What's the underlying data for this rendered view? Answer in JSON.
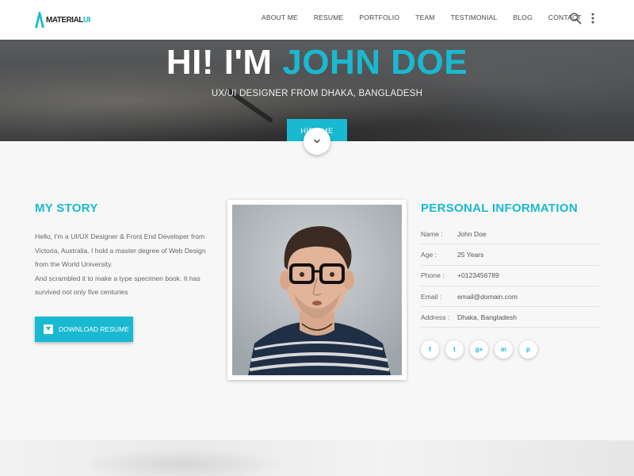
{
  "brand": {
    "logo_text_main": "MATERIAL",
    "logo_text_accent": "UI"
  },
  "nav": {
    "items": [
      "ABOUT ME",
      "RESUME",
      "PORTFOLIO",
      "TEAM",
      "TESTIMONIAL",
      "BLOG",
      "CONTACT"
    ],
    "search_icon": "search-icon",
    "more_icon": "more-vert-icon"
  },
  "hero": {
    "title_prefix": "HI! I'M ",
    "title_name": "JOHN DOE",
    "subtitle": "UX/UI DESIGNER FROM DHAKA, BANGLADESH",
    "hire_button": "HIRE ME"
  },
  "story": {
    "title": "MY STORY",
    "paragraph1": "Hello, I'm a UI/UX Designer & Front End Developer from Victoria, Australia. I hold a master degree of Web Design from the World University.",
    "paragraph2": "And scrambled it to make a type specimen book. It has survived not only five centuries",
    "download_button": "DOWNLOAD RESUME"
  },
  "personal": {
    "title": "PERSONAL INFORMATION",
    "rows": [
      {
        "label": "Name :",
        "value": "John Doe"
      },
      {
        "label": "Age :",
        "value": "25 Years"
      },
      {
        "label": "Phone :",
        "value": "+0123456789"
      },
      {
        "label": "Email :",
        "value": "email@domain.com"
      },
      {
        "label": "Address :",
        "value": "Dhaka, Bangladesh"
      }
    ],
    "socials": [
      {
        "name": "facebook-icon",
        "glyph": "f"
      },
      {
        "name": "twitter-icon",
        "glyph": "t"
      },
      {
        "name": "google-plus-icon",
        "glyph": "g+"
      },
      {
        "name": "linkedin-icon",
        "glyph": "in"
      },
      {
        "name": "pinterest-icon",
        "glyph": "p"
      }
    ]
  },
  "colors": {
    "accent": "#19b9d2",
    "background": "#f7f7f7"
  }
}
